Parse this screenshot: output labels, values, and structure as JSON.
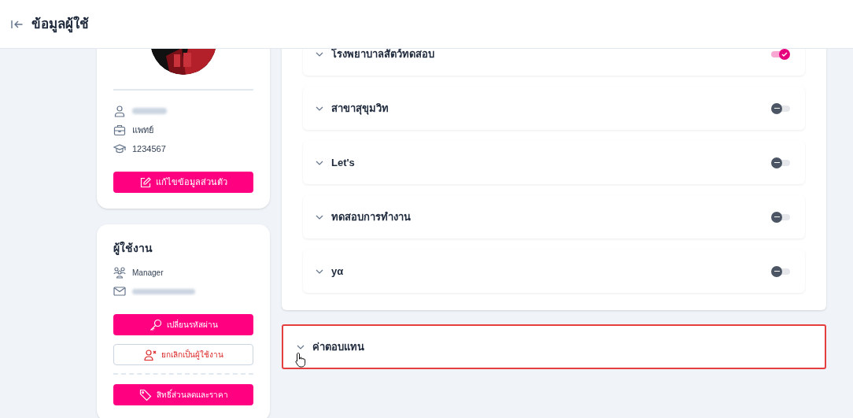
{
  "header": {
    "title": "ข้อมูลผู้ใช้"
  },
  "profile": {
    "rows": [
      {
        "kind": "occupation",
        "text": "แพทย์"
      },
      {
        "kind": "license",
        "text": "1234567"
      }
    ],
    "edit_button": "แก้ไขข้อมูลส่วนตัว"
  },
  "user": {
    "title": "ผู้ใช้งาน",
    "role": "Manager",
    "buttons": [
      {
        "kind": "password",
        "label": "เปลี่ยนรหัสผ่าน"
      },
      {
        "kind": "revoke",
        "label": "ยกเลิกเป็นผู้ใช้งาน"
      },
      {
        "kind": "discount",
        "label": "สิทธิ์ส่วนลดและราคา"
      }
    ]
  },
  "branches": [
    {
      "name": "โรงพยาบาลสัตว์ทดสอบ",
      "on": true
    },
    {
      "name": "สาขาสุขุมวิท",
      "on": false
    },
    {
      "name": "Let's",
      "on": false
    },
    {
      "name": "ทดสอบการทำงาน",
      "on": false
    },
    {
      "name": "yα",
      "on": false
    }
  ],
  "compensation": {
    "title": "ค่าตอบแทน",
    "focused": true
  }
}
